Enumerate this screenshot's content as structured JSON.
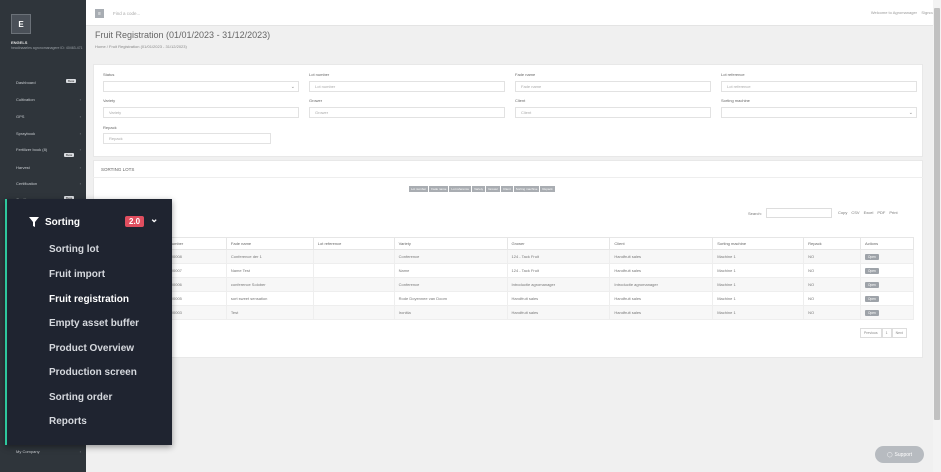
{
  "sidebar": {
    "logo": "E",
    "user_name": "ENGELS",
    "user_sub": "headinaaeles agronomanagere ID: 40463-471",
    "items": [
      {
        "label": "Dashboard",
        "badge": "Beta"
      },
      {
        "label": "Cultivation"
      },
      {
        "label": "GPS"
      },
      {
        "label": "Spraybook"
      },
      {
        "label": "Fertilizer book (8)",
        "badge": "Beta"
      },
      {
        "label": "Harvest"
      },
      {
        "label": "Certification"
      },
      {
        "label": "Quality",
        "badge": "Beta"
      },
      {
        "label": "My Company"
      }
    ]
  },
  "topbar": {
    "search_placeholder": "Find a code...",
    "welcome": "Welcome to Agromanager",
    "signout": "Signout"
  },
  "page": {
    "title": "Fruit Registration (01/01/2023 - 31/12/2023)",
    "breadcrumb": "Home / Fruit Registration (01/01/2023 - 31/12/2023)"
  },
  "filters": {
    "status": {
      "label": "Status",
      "value": ""
    },
    "lot_number": {
      "label": "Lot number",
      "placeholder": "Lot number"
    },
    "fade_name": {
      "label": "Fade name",
      "placeholder": "Fade name"
    },
    "lot_reference": {
      "label": "Lot reference",
      "placeholder": "Lot reference"
    },
    "variety": {
      "label": "Variety",
      "placeholder": "Variety"
    },
    "grower": {
      "label": "Grower",
      "placeholder": "Grower"
    },
    "client": {
      "label": "Client",
      "placeholder": "Client"
    },
    "sorting_machine": {
      "label": "Sorting machine",
      "value": ""
    },
    "repack": {
      "label": "Repack",
      "placeholder": "Repack"
    }
  },
  "lots": {
    "section_title": "SORTING LOTS",
    "column_toggles": [
      "Lot number",
      "Fade name",
      "Lot reference",
      "Variety",
      "Grower",
      "Client",
      "Sorting machine",
      "Repack"
    ],
    "search_label": "Search:",
    "export_buttons": [
      "Copy",
      "CSV",
      "Excel",
      "PDF",
      "Print"
    ],
    "headers": [
      "Lot number",
      "Fade name",
      "Lot reference",
      "Variety",
      "Grower",
      "Client",
      "Sorting machine",
      "Repack",
      "Actions"
    ],
    "rows": [
      [
        "2023/0008",
        "Conference der 1",
        "",
        "Conference",
        "124 - Tack Fruit",
        "Handfruit sales",
        "Machine 1",
        "NO"
      ],
      [
        "2023/0007",
        "Name Test",
        "",
        "Name",
        "124 - Tack Fruit",
        "Handfruit sales",
        "Machine 1",
        "NO"
      ],
      [
        "2023/0006",
        "conference Solober",
        "",
        "Conference",
        "Introductie agromanager",
        "Introductie agromanager",
        "Machine 1",
        "NO"
      ],
      [
        "2023/0005",
        "sort sweet sensation",
        "",
        "Rode Doyennee van Doorn",
        "Handfruit sales",
        "Handfruit sales",
        "Machine 1",
        "NO"
      ],
      [
        "2023/0003",
        "Test",
        "",
        "Ironitia",
        "Handfruit sales",
        "Handfruit sales",
        "Machine 1",
        "NO"
      ]
    ],
    "open_label": "Open",
    "pager": [
      "Previous",
      "1",
      "Next"
    ]
  },
  "flyout": {
    "title": "Sorting",
    "badge": "2.0",
    "items": [
      "Sorting lot",
      "Fruit import",
      "Fruit registration",
      "Empty asset buffer",
      "Product Overview",
      "Production screen",
      "Sorting order",
      "Reports"
    ],
    "active_index": 2,
    "accent": "#2ec79d"
  },
  "support": {
    "label": "Support"
  }
}
